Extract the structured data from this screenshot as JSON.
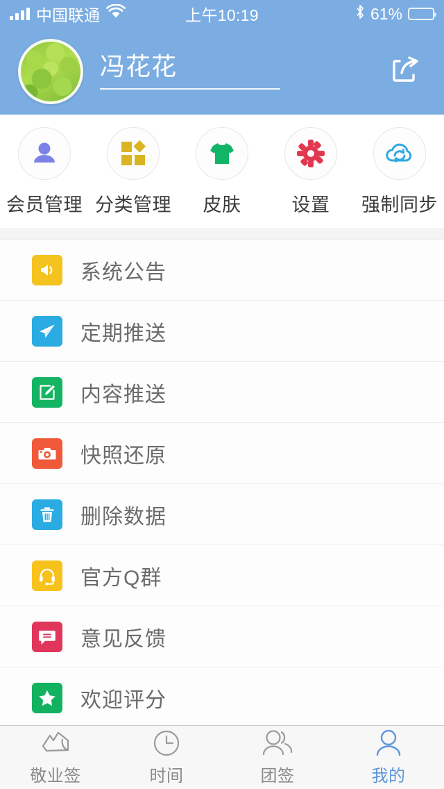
{
  "status_bar": {
    "carrier": "中国联通",
    "time": "上午10:19",
    "battery_percent": "61%",
    "battery_level": 61,
    "wifi_icon": "wifi-icon",
    "signal_icon": "signal-bars-icon",
    "bluetooth_icon": "bluetooth-icon"
  },
  "header": {
    "username": "冯花花",
    "avatar_icon": "avatar-image",
    "share_icon": "share-icon",
    "background_color": "#7badE2"
  },
  "quick_actions": [
    {
      "label": "会员管理",
      "icon": "person-icon",
      "color": "#7b83e8"
    },
    {
      "label": "分类管理",
      "icon": "grid-icon",
      "color": "#d8b521"
    },
    {
      "label": "皮肤",
      "icon": "tshirt-icon",
      "color": "#11b565"
    },
    {
      "label": "设置",
      "icon": "gear-icon",
      "color": "#e2384f"
    },
    {
      "label": "强制同步",
      "icon": "cloud-sync-icon",
      "color": "#2fa9e0"
    }
  ],
  "menu_items": [
    {
      "label": "系统公告",
      "icon": "speaker-icon",
      "color": "#f5c320"
    },
    {
      "label": "定期推送",
      "icon": "paper-plane-icon",
      "color": "#2aabe2"
    },
    {
      "label": "内容推送",
      "icon": "edit-icon",
      "color": "#14b463"
    },
    {
      "label": "快照还原",
      "icon": "camera-icon",
      "color": "#f05a3b"
    },
    {
      "label": "删除数据",
      "icon": "trash-icon",
      "color": "#2aabe2"
    },
    {
      "label": "官方Q群",
      "icon": "headset-icon",
      "color": "#f7c21c"
    },
    {
      "label": "意见反馈",
      "icon": "chat-icon",
      "color": "#e0365c"
    },
    {
      "label": "欢迎评分",
      "icon": "star-icon",
      "color": "#12b261"
    }
  ],
  "tabs": [
    {
      "label": "敬业签",
      "icon": "note-icon",
      "active": false
    },
    {
      "label": "时间",
      "icon": "clock-icon",
      "active": false
    },
    {
      "label": "团签",
      "icon": "group-icon",
      "active": false
    },
    {
      "label": "我的",
      "icon": "profile-icon",
      "active": true
    }
  ],
  "theme": {
    "accent": "#7badE2",
    "active_tab_color": "#5e96d9",
    "list_text_color": "#6b6b6b"
  }
}
